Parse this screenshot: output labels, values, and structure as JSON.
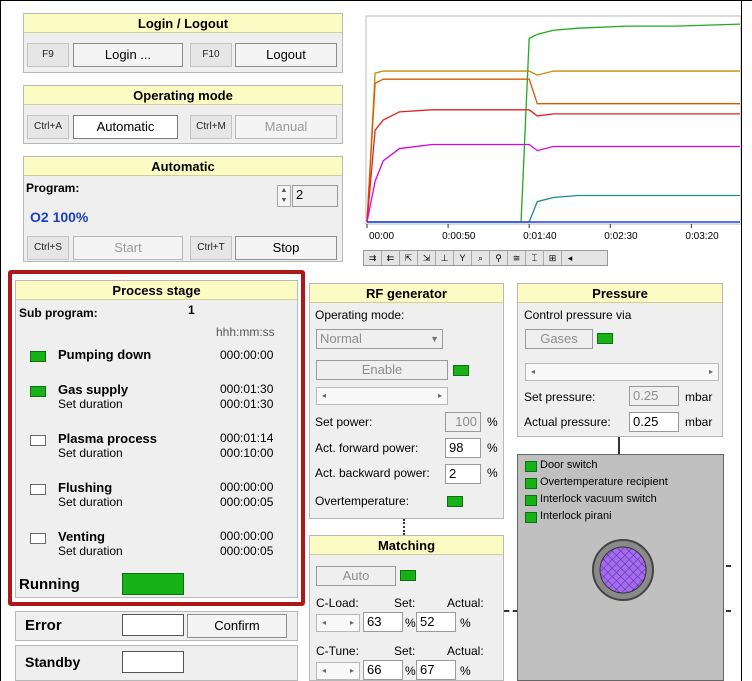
{
  "login": {
    "title": "Login / Logout",
    "login_key": "F9",
    "login_label": "Login ...",
    "logout_key": "F10",
    "logout_label": "Logout"
  },
  "operating_mode": {
    "title": "Operating mode",
    "auto_key": "Ctrl+A",
    "auto_label": "Automatic",
    "manual_key": "Ctrl+M",
    "manual_label": "Manual"
  },
  "automatic": {
    "title": "Automatic",
    "program_label": "Program:",
    "program_value": "2",
    "program_name": "O2 100%",
    "start_key": "Ctrl+S",
    "start_label": "Start",
    "stop_key": "Ctrl+T",
    "stop_label": "Stop"
  },
  "chart": {
    "x_ticks": [
      "00:00",
      "0:00:50",
      "0:01:40",
      "0:02:30",
      "0:03:20"
    ],
    "colors": {
      "green": "#1faa1f",
      "orange": "#c98a00",
      "darkorange": "#d85a00",
      "red": "#e02020",
      "magenta": "#e000e0",
      "teal": "#1c8c8c",
      "blue": "#2040e0"
    }
  },
  "chart_data": {
    "type": "line",
    "x_label_ticks": [
      "00:00",
      "0:00:50",
      "0:01:40",
      "0:02:30",
      "0:03:20"
    ],
    "x": [
      0,
      5,
      10,
      20,
      40,
      60,
      80,
      95,
      100,
      105,
      115,
      130,
      160,
      190,
      230
    ],
    "series": [
      {
        "color": "#1faa1f",
        "values": [
          0,
          0,
          0,
          0,
          0,
          0,
          0,
          0,
          90,
          92,
          94,
          95,
          96,
          96,
          97
        ]
      },
      {
        "color": "#c98a00",
        "values": [
          0,
          73,
          74,
          74,
          74,
          74,
          74,
          74,
          74,
          72,
          74,
          74,
          74,
          74,
          74
        ]
      },
      {
        "color": "#d85a00",
        "values": [
          0,
          68,
          70,
          70,
          70,
          70,
          70,
          70,
          70,
          58,
          58,
          58,
          58,
          58,
          58
        ]
      },
      {
        "color": "#e02020",
        "values": [
          0,
          45,
          50,
          54,
          55,
          55,
          55,
          55,
          55,
          52,
          53,
          53,
          53,
          53,
          53
        ]
      },
      {
        "color": "#e000e0",
        "values": [
          0,
          20,
          30,
          36,
          38,
          38,
          38,
          38,
          38,
          35,
          37,
          37,
          37,
          37,
          37
        ]
      },
      {
        "color": "#1c8c8c",
        "values": [
          0,
          0,
          0,
          0,
          0,
          0,
          0,
          0,
          0,
          10,
          12,
          13,
          13,
          13,
          13
        ]
      }
    ],
    "xlim": [
      0,
      230
    ],
    "ylim": [
      0,
      100
    ],
    "grid": false
  },
  "process_stage": {
    "title": "Process stage",
    "sub_program_label": "Sub program:",
    "sub_program_value": "1",
    "time_format": "hhh:mm:ss",
    "stages": [
      {
        "name": "Pumping down",
        "time": "000:00:00",
        "set_label": "",
        "set_time": "",
        "active": true
      },
      {
        "name": "Gas supply",
        "time": "000:01:30",
        "set_label": "Set duration",
        "set_time": "000:01:30",
        "active": true
      },
      {
        "name": "Plasma process",
        "time": "000:01:14",
        "set_label": "Set duration",
        "set_time": "000:10:00",
        "active": false
      },
      {
        "name": "Flushing",
        "time": "000:00:00",
        "set_label": "Set duration",
        "set_time": "000:00:05",
        "active": false
      },
      {
        "name": "Venting",
        "time": "000:00:00",
        "set_label": "Set duration",
        "set_time": "000:00:05",
        "active": false
      }
    ],
    "running_label": "Running"
  },
  "status": {
    "error_label": "Error",
    "confirm_label": "Confirm",
    "standby_label": "Standby"
  },
  "rf": {
    "title": "RF generator",
    "op_mode_label": "Operating mode:",
    "op_mode_value": "Normal",
    "enable_label": "Enable",
    "set_power_label": "Set power:",
    "set_power_value": "100",
    "set_power_unit": "%",
    "fwd_label": "Act. forward power:",
    "fwd_value": "98",
    "fwd_unit": "%",
    "bwd_label": "Act. backward power:",
    "bwd_value": "2",
    "bwd_unit": "%",
    "overtemp_label": "Overtemperature:"
  },
  "matching": {
    "title": "Matching",
    "auto_label": "Auto",
    "cload_label": "C-Load:",
    "cload_set_label": "Set:",
    "cload_set": "63",
    "cload_unit1": "%",
    "cload_actual_label": "Actual:",
    "cload_actual": "52",
    "cload_unit2": "%",
    "ctune_label": "C-Tune:",
    "ctune_set_label": "Set:",
    "ctune_set": "66",
    "ctune_unit1": "%",
    "ctune_actual_label": "Actual:",
    "ctune_actual": "67",
    "ctune_unit2": "%"
  },
  "pressure": {
    "title": "Pressure",
    "control_label": "Control pressure via",
    "gases_label": "Gases",
    "set_label": "Set pressure:",
    "set_value": "0.25",
    "set_unit": "mbar",
    "actual_label": "Actual pressure:",
    "actual_value": "0.25",
    "actual_unit": "mbar"
  },
  "interlocks": [
    {
      "label": "Door switch"
    },
    {
      "label": "Overtemperature recipient"
    },
    {
      "label": "Interlock vacuum switch"
    },
    {
      "label": "Interlock pirani"
    }
  ]
}
